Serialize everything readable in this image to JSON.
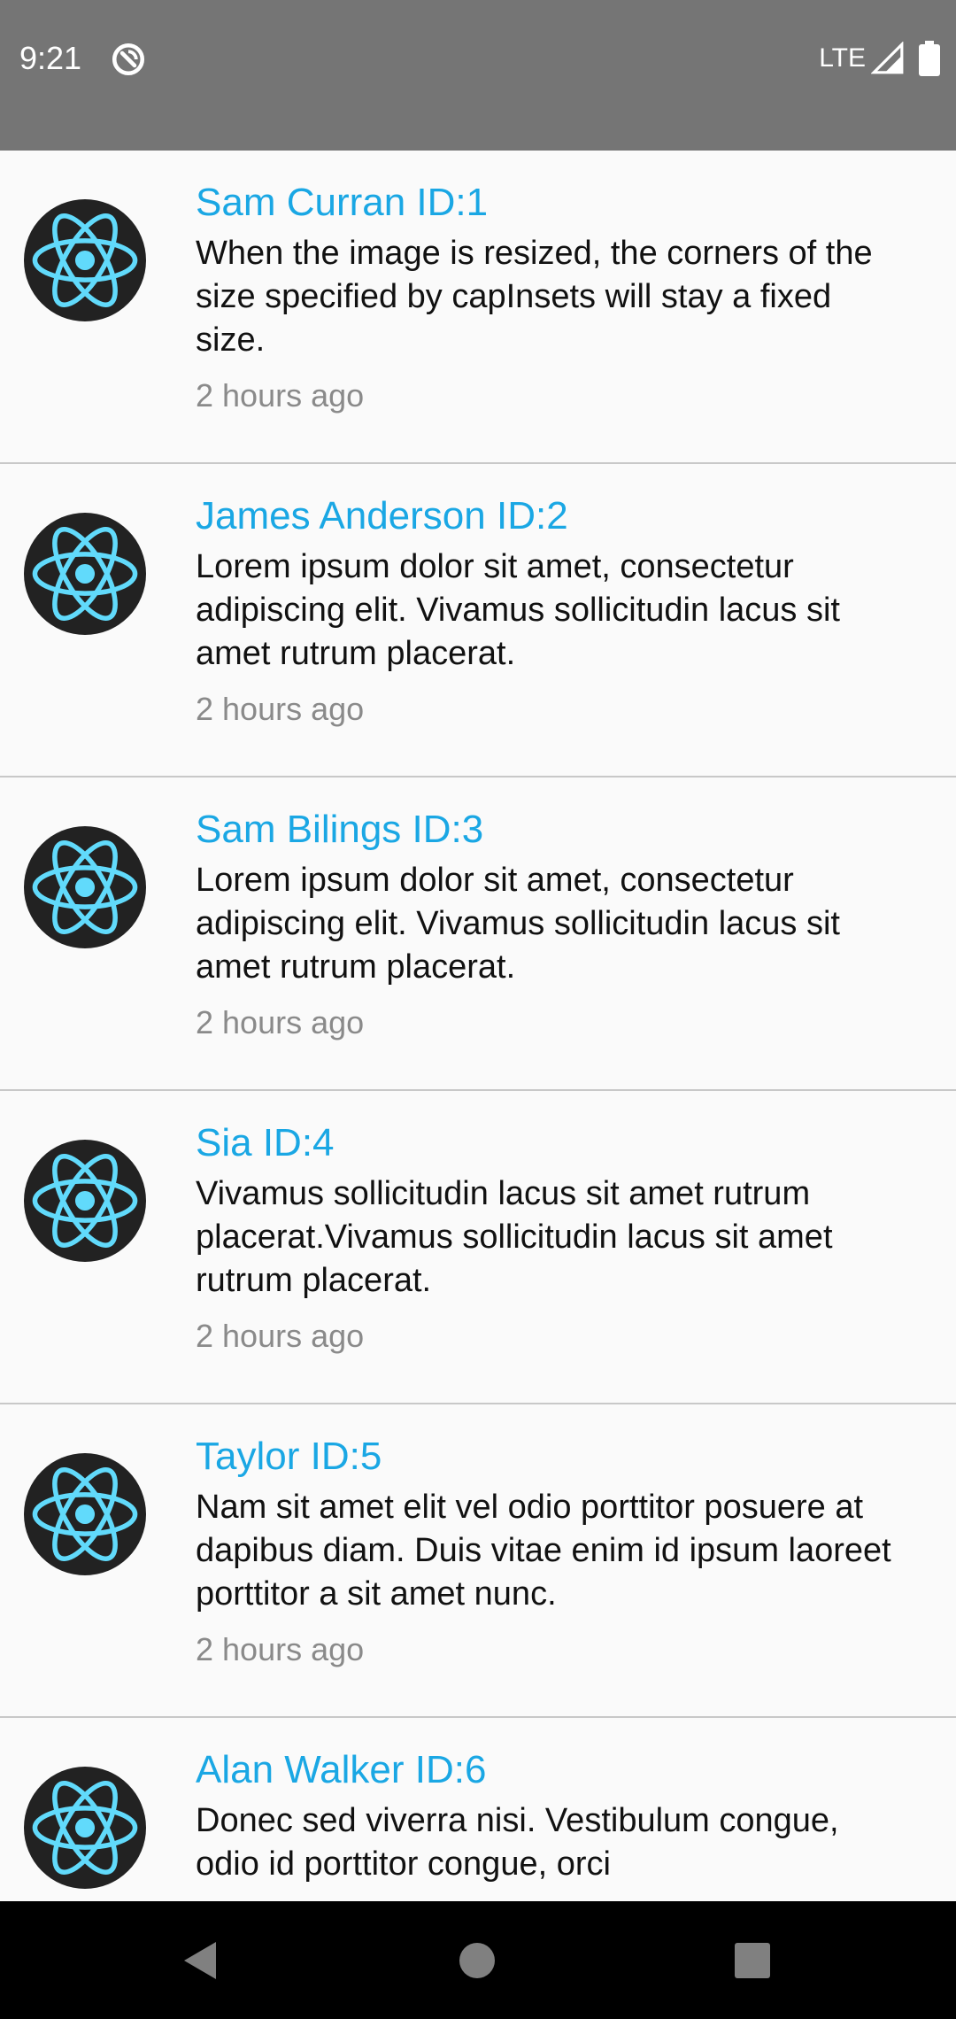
{
  "status_bar": {
    "time": "9:21",
    "network": "LTE",
    "icons": [
      "sync-icon",
      "signal-icon",
      "battery-icon"
    ]
  },
  "theme": {
    "accent": "#1aa7e4",
    "status_bar_bg": "#757575",
    "avatar_bg": "#222222",
    "logo_color": "#61dafb"
  },
  "feed": {
    "avatar_icon": "react-logo-icon",
    "items": [
      {
        "title": "Sam Curran ID:1",
        "text": "When the image is resized, the corners of the size specified by capInsets will stay a fixed size.",
        "time": "2 hours ago"
      },
      {
        "title": "James Anderson ID:2",
        "text": "Lorem ipsum dolor sit amet, consectetur adipiscing elit. Vivamus sollicitudin lacus sit amet rutrum placerat.",
        "time": "2 hours ago"
      },
      {
        "title": "Sam Bilings ID:3",
        "text": "Lorem ipsum dolor sit amet, consectetur adipiscing elit. Vivamus sollicitudin lacus sit amet rutrum placerat.",
        "time": "2 hours ago"
      },
      {
        "title": "Sia ID:4",
        "text": "Vivamus sollicitudin lacus sit amet rutrum placerat.Vivamus sollicitudin lacus sit amet rutrum placerat.",
        "time": "2 hours ago"
      },
      {
        "title": "Taylor ID:5",
        "text": "Nam sit amet elit vel odio porttitor posuere at dapibus diam. Duis vitae enim id ipsum laoreet porttitor a sit amet nunc.",
        "time": "2 hours ago"
      },
      {
        "title": "Alan Walker ID:6",
        "text": "Donec sed viverra nisi. Vestibulum congue, odio id porttitor congue, orci",
        "time": ""
      }
    ]
  },
  "nav_bar": {
    "buttons": [
      "back-icon",
      "home-icon",
      "recents-icon"
    ]
  }
}
